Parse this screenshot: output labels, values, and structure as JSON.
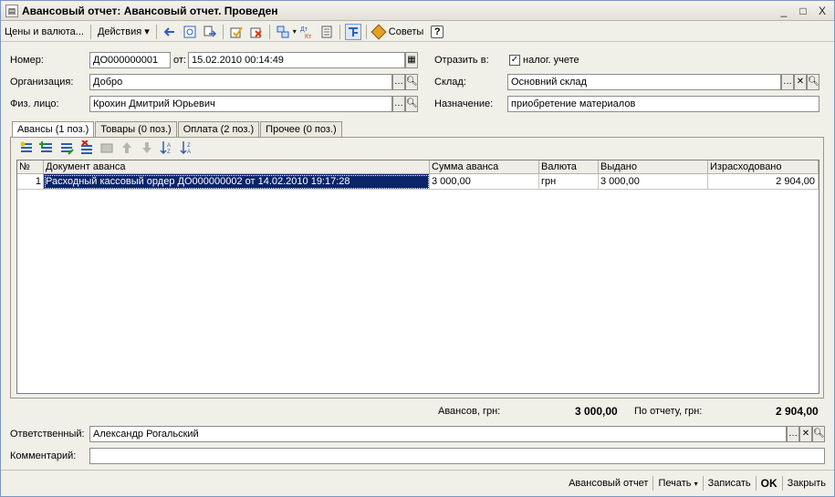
{
  "window": {
    "title": "Авансовый отчет: Авансовый отчет. Проведен",
    "minimize": "_",
    "maximize": "□",
    "close": "X"
  },
  "toolbar": {
    "prices_currency": "Цены и валюта...",
    "actions": "Действия",
    "tips": "Советы",
    "help": "?"
  },
  "form": {
    "number_label": "Номер:",
    "number_value": "ДО000000001",
    "date_label": "от:",
    "date_value": "15.02.2010 00:14:49",
    "reflect_label": "Отразить в:",
    "tax_label": "налог. учете",
    "tax_checked": true,
    "org_label": "Организация:",
    "org_value": "Добро",
    "warehouse_label": "Склад:",
    "warehouse_value": "Основний склад",
    "person_label": "Физ. лицо:",
    "person_value": "Крохин Дмитрий Юрьевич",
    "purpose_label": "Назначение:",
    "purpose_value": "приобретение материалов"
  },
  "tabs": [
    {
      "label": "Авансы (1 поз.)",
      "active": true
    },
    {
      "label": "Товары (0 поз.)",
      "active": false
    },
    {
      "label": "Оплата (2 поз.)",
      "active": false
    },
    {
      "label": "Прочее (0 поз.)",
      "active": false
    }
  ],
  "table": {
    "columns": [
      "№",
      "Документ аванса",
      "Сумма аванса",
      "Валюта",
      "Выдано",
      "Израсходовано"
    ],
    "rows": [
      {
        "num": "1",
        "doc": "Расходный кассовый ордер ДО000000002 от 14.02.2010 19:17:28",
        "sum": "3 000,00",
        "currency": "грн",
        "issued": "3 000,00",
        "spent": "2 904,00"
      }
    ]
  },
  "totals": {
    "advances_label": "Авансов, грн:",
    "advances_value": "3 000,00",
    "report_label": "По отчету, грн:",
    "report_value": "2 904,00"
  },
  "responsible": {
    "label": "Ответственный:",
    "value": "Александр Рогальский"
  },
  "comment": {
    "label": "Комментарий:",
    "value": ""
  },
  "bottom": {
    "report": "Авансовый отчет",
    "print": "Печать",
    "save": "Записать",
    "ok": "OK",
    "close": "Закрыть"
  },
  "colors": {
    "selection": "#0a246a",
    "accent_blue": "#2b5fb8"
  }
}
